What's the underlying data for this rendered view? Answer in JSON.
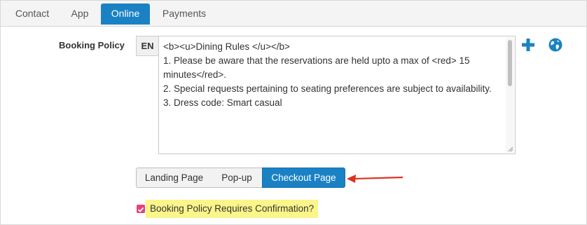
{
  "tabs": [
    {
      "label": "Contact",
      "active": false
    },
    {
      "label": "App",
      "active": false
    },
    {
      "label": "Online",
      "active": true
    },
    {
      "label": "Payments",
      "active": false
    }
  ],
  "booking_policy": {
    "label": "Booking Policy",
    "language": "EN",
    "text": "<b><u>Dining Rules </u></b>\n1. Please be aware that the reservations are held upto a max of <red> 15 minutes</red>.\n2. Special requests pertaining to seating preferences are subject to availability.\n3. Dress code: Smart casual"
  },
  "icons": {
    "add": "plus-icon",
    "language": "globe-icon"
  },
  "page_buttons": [
    {
      "label": "Landing Page",
      "active": false
    },
    {
      "label": "Pop-up",
      "active": false
    },
    {
      "label": "Checkout Page",
      "active": true
    }
  ],
  "confirmation": {
    "label": "Booking Policy Requires Confirmation?",
    "checked": true
  },
  "colors": {
    "accent": "#1a82c4",
    "arrow": "#e0301e",
    "highlight": "#fbf58a",
    "checkbox": "#e8417d"
  }
}
